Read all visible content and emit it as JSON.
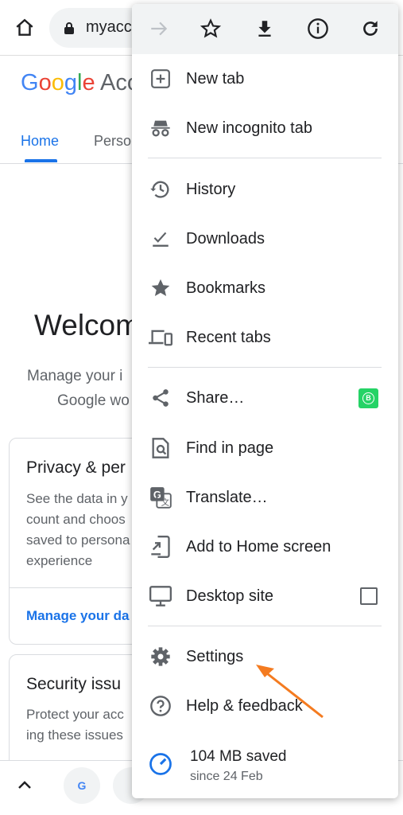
{
  "browser": {
    "url": "myaccount.google.com",
    "url_visible": "myacc"
  },
  "page": {
    "logo": "Google",
    "logo_suffix": "Account",
    "tabs": [
      "Home",
      "Personal info"
    ],
    "tabs_visible": [
      "Home",
      "Perso"
    ],
    "welcome": "Welcom",
    "subtitle_line1": "Manage your i",
    "subtitle_line2": "Google wo",
    "privacy_title": "Privacy & per",
    "privacy_body": [
      "See the data in y",
      "count and choos",
      "saved to persona",
      "experience"
    ],
    "privacy_link": "Manage your da",
    "security_title": "Security issu",
    "security_body": [
      "Protect your acc",
      "ing these issues"
    ]
  },
  "menu": {
    "toolbar": [
      "forward-icon",
      "bookmark-star-icon",
      "download-icon",
      "info-icon",
      "reload-icon"
    ],
    "items": [
      {
        "label": "New tab",
        "icon": "new-tab-icon"
      },
      {
        "label": "New incognito tab",
        "icon": "incognito-icon"
      },
      {
        "label": "History",
        "icon": "history-icon"
      },
      {
        "label": "Downloads",
        "icon": "downloads-icon"
      },
      {
        "label": "Bookmarks",
        "icon": "star-icon"
      },
      {
        "label": "Recent tabs",
        "icon": "devices-icon"
      },
      {
        "label": "Share…",
        "icon": "share-icon"
      },
      {
        "label": "Find in page",
        "icon": "find-icon"
      },
      {
        "label": "Translate…",
        "icon": "translate-icon"
      },
      {
        "label": "Add to Home screen",
        "icon": "add-home-icon"
      },
      {
        "label": "Desktop site",
        "icon": "desktop-icon"
      },
      {
        "label": "Settings",
        "icon": "gear-icon"
      },
      {
        "label": "Help & feedback",
        "icon": "help-icon"
      }
    ],
    "saved": {
      "amount": "104 MB saved",
      "since": "since 24 Feb"
    },
    "desktop_site_checked": false
  },
  "colors": {
    "accent": "#1a73e8",
    "annotation_arrow": "#f47b20",
    "whatsapp": "#25d366"
  }
}
